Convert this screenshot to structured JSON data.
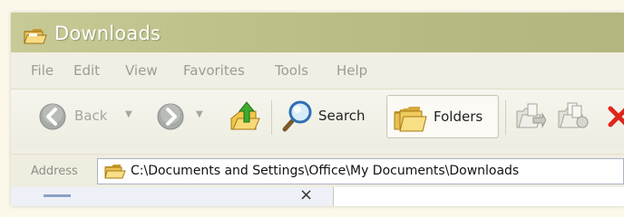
{
  "window": {
    "title": "Downloads",
    "title_icon": "folder-icon"
  },
  "menu": {
    "items": [
      {
        "label": "File"
      },
      {
        "label": "Edit"
      },
      {
        "label": "View"
      },
      {
        "label": "Favorites"
      },
      {
        "label": "Tools"
      },
      {
        "label": "Help"
      }
    ]
  },
  "toolbar": {
    "back_label": "Back",
    "search_label": "Search",
    "folders_label": "Folders",
    "back_icon": "arrow-left-icon",
    "forward_icon": "arrow-right-icon",
    "up_icon": "folder-up-icon",
    "search_icon": "magnifier-icon",
    "folders_icon": "folders-icon",
    "move_to_icon": "move-to-icon",
    "copy_to_icon": "copy-to-icon",
    "delete_icon": "delete-x-icon"
  },
  "address": {
    "label": "Address",
    "value": "C:\\Documents and Settings\\Office\\My Documents\\Downloads"
  },
  "pane": {
    "close_glyph": "×"
  },
  "colors": {
    "titlebar": "#bec189",
    "nav_green": "#9aa09a",
    "delete_red": "#e0261a",
    "folder_yellow": "#f1c84a"
  }
}
